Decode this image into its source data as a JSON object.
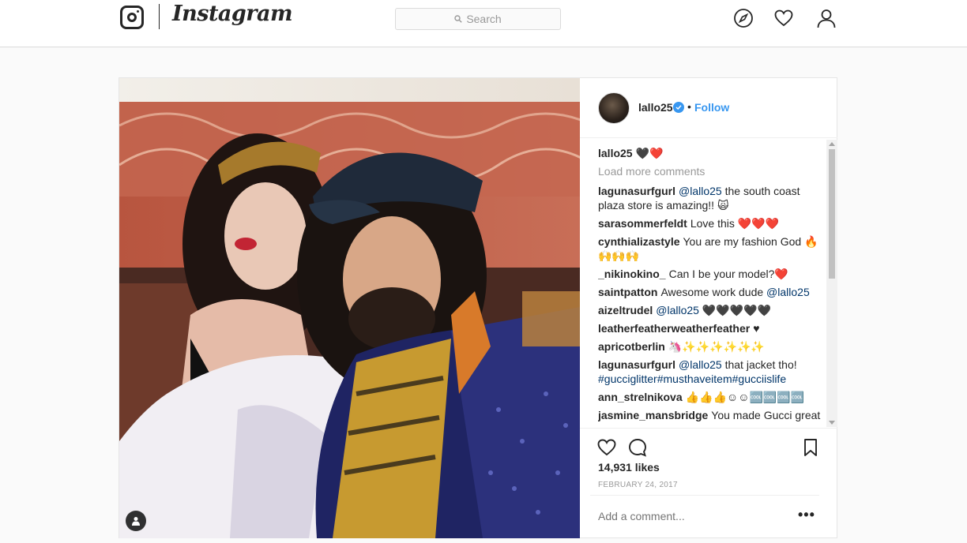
{
  "app": {
    "wordmark": "Instagram"
  },
  "search": {
    "placeholder": "Search"
  },
  "nav": {
    "icons": [
      "compass-icon",
      "heart-icon",
      "person-icon"
    ]
  },
  "post": {
    "username": "lallo25",
    "separator": "•",
    "follow_label": "Follow",
    "caption_user": "lallo25",
    "caption_text": "🖤❤️",
    "load_more": "Load more comments",
    "comments": [
      {
        "user": "lagunasurfgurl",
        "mention": "@lallo25",
        "text": " the south coast plaza store is amazing!! 🙀"
      },
      {
        "user": "sarasommerfeldt",
        "mention": "",
        "text": "Love this ❤️❤️❤️"
      },
      {
        "user": "cynthializastyle",
        "mention": "",
        "text": "You are my fashion God 🔥🙌🙌🙌"
      },
      {
        "user": "_nikinokino_",
        "mention": "",
        "text": "Can I be your model?❤️"
      },
      {
        "user": "saintpatton",
        "mention": "@lallo25",
        "prefix": "Awesome work dude ",
        "text": ""
      },
      {
        "user": "aizeltrudel",
        "mention": "@lallo25",
        "text": " 🖤🖤🖤🖤🖤"
      },
      {
        "user": "leatherfeatherweatherfeather",
        "mention": "",
        "text": "♥"
      },
      {
        "user": "apricotberlin",
        "mention": "",
        "text": "🦄✨✨✨✨✨✨"
      },
      {
        "user": "lagunasurfgurl",
        "mention": "@lallo25",
        "text": " that jacket tho!",
        "tags": "#gucciglitter#musthaveitem#gucciislife"
      },
      {
        "user": "ann_strelnikova",
        "mention": "",
        "text": "👍👍👍☺☺🆒🆒🆒🆒"
      },
      {
        "user": "jasmine_mansbridge",
        "mention": "",
        "text": "You made Gucci great"
      }
    ],
    "likes": "14,931 likes",
    "date": "FEBRUARY 24, 2017",
    "add_comment_placeholder": "Add a comment...",
    "more_label": "•••"
  },
  "colors": {
    "link": "#3897f0",
    "mention": "#003569",
    "border": "#dbdbdb",
    "muted": "#999999"
  }
}
